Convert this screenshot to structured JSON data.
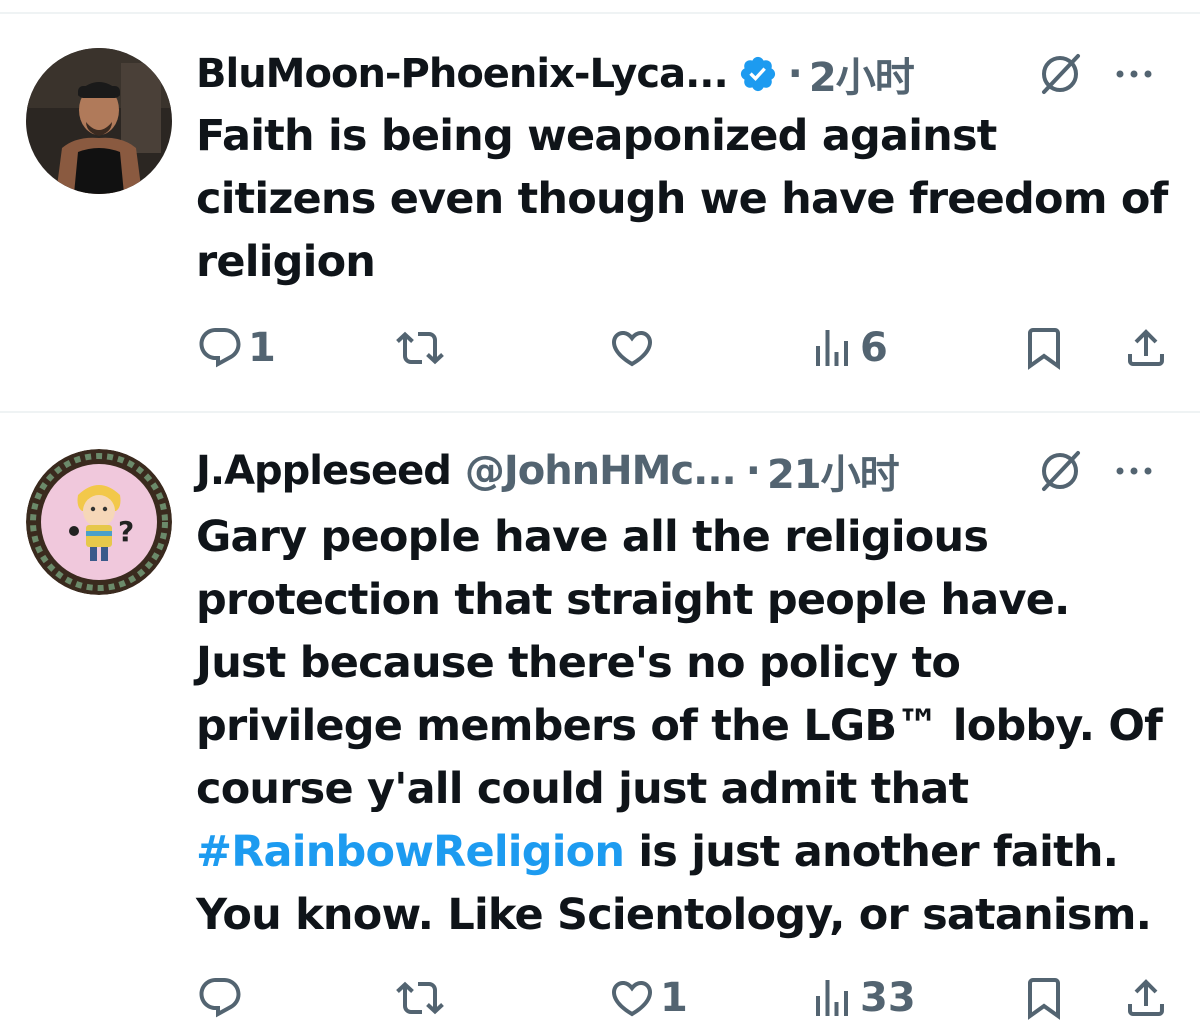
{
  "colors": {
    "accent": "#1d9bf0",
    "text_primary": "#0f1419",
    "text_secondary": "#536471",
    "divider": "#eff3f4"
  },
  "tweets": [
    {
      "display_name": "BluMoon-Phoenix-Lyca...",
      "handle": "",
      "verified": true,
      "separator": "·",
      "time": "2小时",
      "avatar_icon": "man-tank-top-photo-avatar",
      "lines": [
        "Faith is being weaponized against",
        "citizens even though we have freedom of",
        "religion"
      ],
      "actions": {
        "reply_count": "1",
        "retweet_count": "",
        "like_count": "",
        "views_count": "6"
      }
    },
    {
      "display_name": "J.Appleseed",
      "handle": "@JohnHMc...",
      "verified": false,
      "separator": "·",
      "time": "21小时",
      "avatar_icon": "cartoon-boy-question-mark-avatar",
      "lines": [
        "Gary people have all the religious",
        "protection that straight people have.",
        "Just because there's no policy to",
        "privilege members of the LGB™ lobby. Of",
        "course y'all could just admit that"
      ],
      "hashtag": "#RainbowReligion",
      "hashtag_line_rest": " is just another faith.",
      "last_line": "You know. Like Scientology, or satanism.",
      "actions": {
        "reply_count": "",
        "retweet_count": "",
        "like_count": "1",
        "views_count": "33"
      }
    }
  ],
  "icons": [
    "reply-icon",
    "retweet-icon",
    "like-icon",
    "views-icon",
    "bookmark-icon",
    "share-icon",
    "grok-icon",
    "more-icon",
    "verified-badge-icon"
  ]
}
